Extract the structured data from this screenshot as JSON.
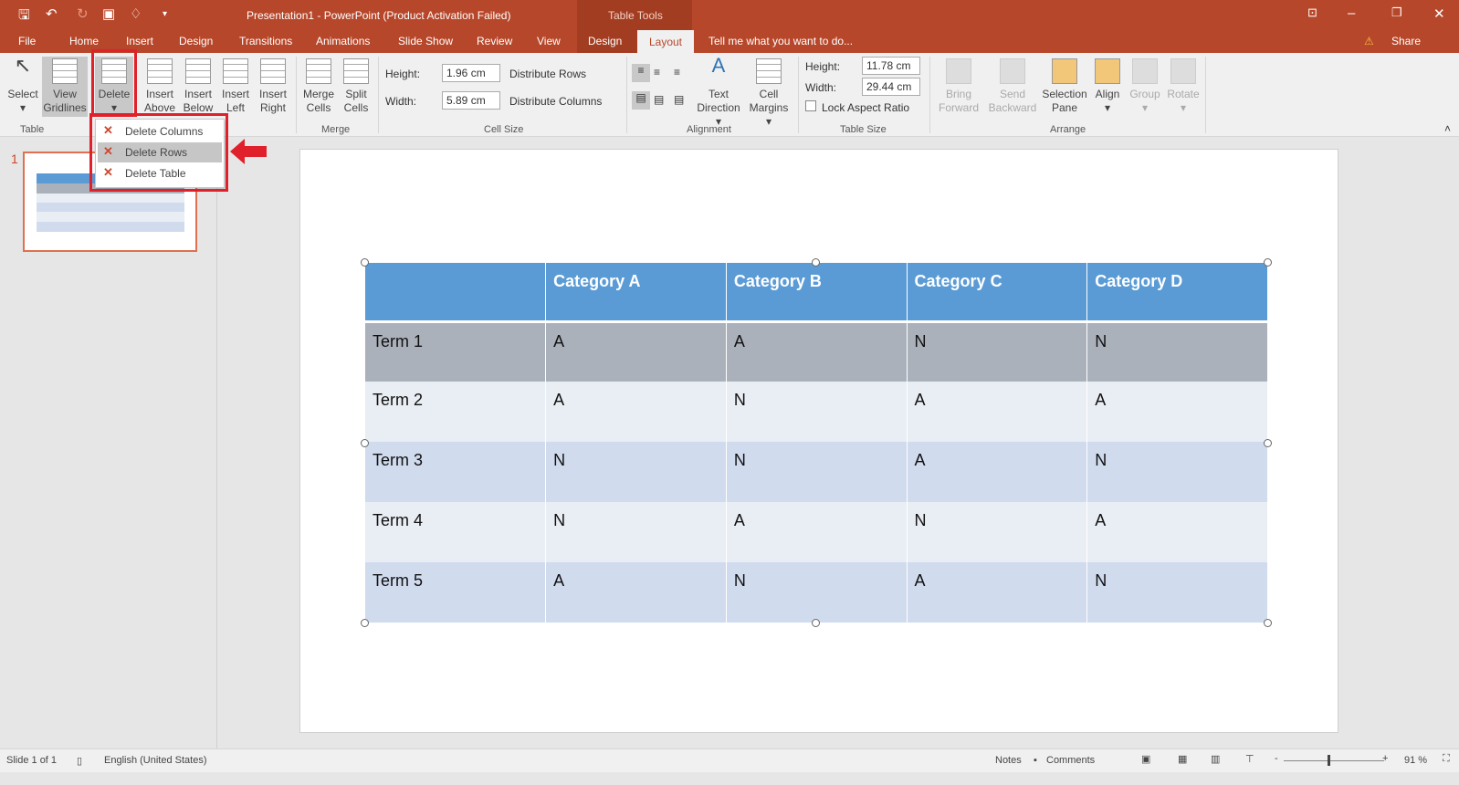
{
  "window": {
    "title": "Presentation1 - PowerPoint (Product Activation Failed)",
    "contextual": "Table Tools",
    "share": "Share",
    "tell_me": "Tell me what you want to do..."
  },
  "tabs": [
    "File",
    "Home",
    "Insert",
    "Design",
    "Transitions",
    "Animations",
    "Slide Show",
    "Review",
    "View",
    "Design",
    "Layout"
  ],
  "ribbon": {
    "table": {
      "label": "Table",
      "select": "Select",
      "view_gridlines": [
        "View",
        "Gridlines"
      ]
    },
    "rows_cols": {
      "delete": "Delete",
      "insert_above": [
        "Insert",
        "Above"
      ],
      "insert_below": [
        "Insert",
        "Below"
      ],
      "insert_left": [
        "Insert",
        "Left"
      ],
      "insert_right": [
        "Insert",
        "Right"
      ]
    },
    "merge": {
      "label": "Merge",
      "merge_cells": [
        "Merge",
        "Cells"
      ],
      "split_cells": [
        "Split",
        "Cells"
      ]
    },
    "cell_size": {
      "label": "Cell Size",
      "height_label": "Height:",
      "height": "1.96 cm",
      "width_label": "Width:",
      "width": "5.89 cm",
      "distribute_rows": "Distribute Rows",
      "distribute_columns": "Distribute Columns"
    },
    "alignment": {
      "label": "Alignment",
      "text_direction": [
        "Text",
        "Direction"
      ],
      "cell_margins": [
        "Cell",
        "Margins"
      ]
    },
    "table_size": {
      "label": "Table Size",
      "height_label": "Height:",
      "height": "11.78 cm",
      "width_label": "Width:",
      "width": "29.44 cm",
      "lock": "Lock Aspect Ratio"
    },
    "arrange": {
      "label": "Arrange",
      "bring_forward": [
        "Bring",
        "Forward"
      ],
      "send_backward": [
        "Send",
        "Backward"
      ],
      "selection_pane": [
        "Selection",
        "Pane"
      ],
      "align": "Align",
      "group": "Group",
      "rotate": "Rotate"
    }
  },
  "delete_menu": [
    "Delete Columns",
    "Delete Rows",
    "Delete Table"
  ],
  "slide_number": "1",
  "table": {
    "headers": [
      "",
      "Category A",
      "Category B",
      "Category C",
      "Category D"
    ],
    "rows": [
      [
        "Term 1",
        "A",
        "A",
        "N",
        "N"
      ],
      [
        "Term 2",
        "A",
        "N",
        "A",
        "A"
      ],
      [
        "Term 3",
        "N",
        "N",
        "A",
        "N"
      ],
      [
        "Term 4",
        "N",
        "A",
        "N",
        "A"
      ],
      [
        "Term 5",
        "A",
        "N",
        "A",
        "N"
      ]
    ]
  },
  "status": {
    "slide": "Slide 1 of 1",
    "language": "English (United States)",
    "notes": "Notes",
    "comments": "Comments",
    "zoom": "91 %"
  },
  "colors": {
    "accent": "#b7472a",
    "header": "#5b9bd5",
    "highlight": "#e0202a"
  }
}
